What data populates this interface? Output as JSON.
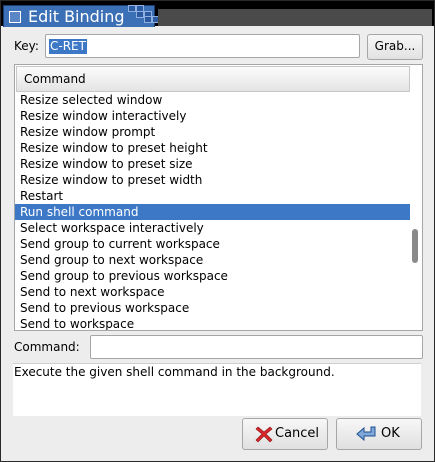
{
  "window": {
    "title": "Edit Binding"
  },
  "key": {
    "label": "Key:",
    "value": "C-RET"
  },
  "grab_button": "Grab...",
  "list": {
    "header": "Command",
    "items": [
      "Resize selected window",
      "Resize window interactively",
      "Resize window prompt",
      "Resize window to preset height",
      "Resize window to preset size",
      "Resize window to preset width",
      "Restart",
      "Run shell command",
      "Select workspace interactively",
      "Send group to current workspace",
      "Send group to next workspace",
      "Send group to previous workspace",
      "Send to next workspace",
      "Send to previous workspace",
      "Send to workspace"
    ],
    "selected_index": 7
  },
  "command": {
    "label": "Command:",
    "value": ""
  },
  "description": "Execute the given shell command in the background.",
  "buttons": {
    "cancel": "Cancel",
    "ok": "OK"
  },
  "colors": {
    "selection": "#3d78c6",
    "title_bar": "#3b6fb6",
    "cancel_icon": "#d9262c",
    "ok_icon": "#3b6fb6"
  },
  "icons": {
    "window_menu": "window-menu-icon",
    "cancel": "cancel-x-icon",
    "ok": "ok-return-arrow-icon"
  }
}
